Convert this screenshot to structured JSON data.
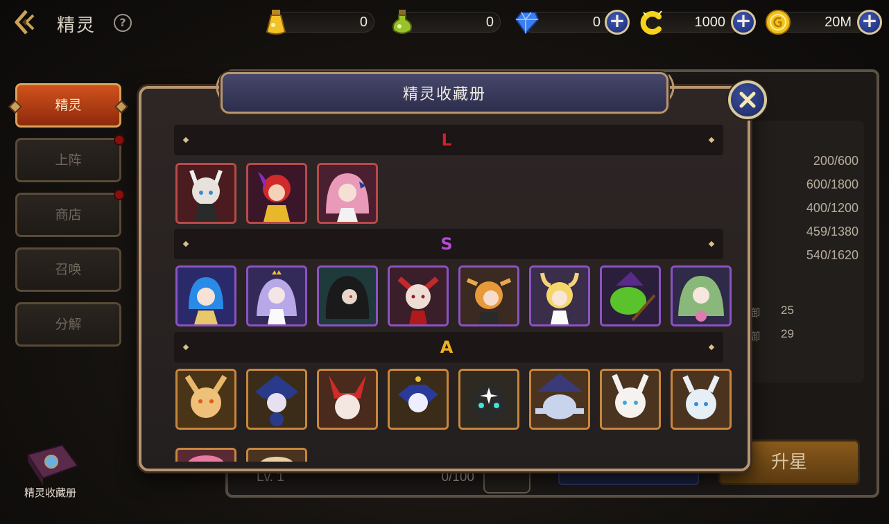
{
  "header": {
    "title": "精灵",
    "help_glyph": "?",
    "resources": [
      {
        "name": "yellow-potion",
        "value": "0",
        "has_plus": false
      },
      {
        "name": "green-potion",
        "value": "0",
        "has_plus": false
      },
      {
        "name": "blue-gem",
        "value": "0",
        "has_plus": true
      },
      {
        "name": "c-coin",
        "value": "1000",
        "has_plus": true
      },
      {
        "name": "gold-coin",
        "value": "20M",
        "has_plus": true
      }
    ],
    "plus_glyph": "+"
  },
  "sidebar": {
    "items": [
      {
        "label": "精灵",
        "active": true,
        "dot": false
      },
      {
        "label": "上阵",
        "active": false,
        "dot": true
      },
      {
        "label": "商店",
        "active": false,
        "dot": true
      },
      {
        "label": "召唤",
        "active": false,
        "dot": false
      },
      {
        "label": "分解",
        "active": false,
        "dot": false
      }
    ],
    "collection_label": "精灵收藏册"
  },
  "background_panel": {
    "stats": [
      "200/600",
      "600/1800",
      "400/1200",
      "459/1380",
      "540/1620"
    ],
    "stat_rows": [
      {
        "label": "御",
        "value": "25"
      },
      {
        "label": "御",
        "value": "29"
      }
    ],
    "level": "Lv. 1",
    "exp": "0/100",
    "upgrade_label": "升星"
  },
  "modal": {
    "title": "精灵收藏册",
    "close_glyph": "✕",
    "grades": [
      {
        "letter": "L",
        "color": "#d0202a",
        "count": 3
      },
      {
        "letter": "S",
        "color": "#b44ad8",
        "count": 8
      },
      {
        "letter": "A",
        "color": "#f0b020",
        "count": 8
      }
    ]
  },
  "colors": {
    "accent_orange": "#d0521c",
    "grade_L": "#b84a4a",
    "grade_S": "#8d52c4",
    "grade_A": "#c9873c",
    "plus_blue": "#2c3f94"
  }
}
